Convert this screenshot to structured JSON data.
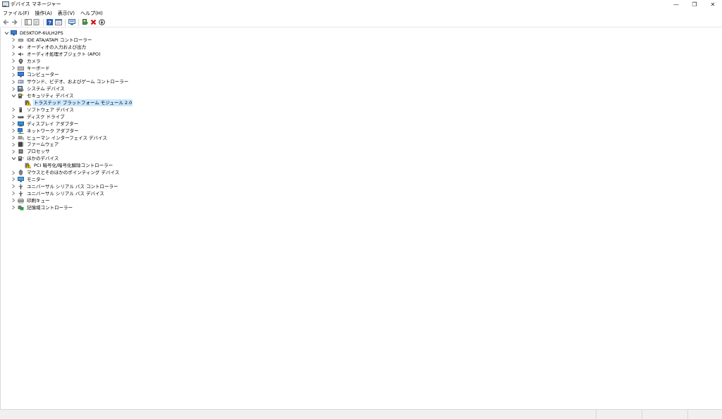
{
  "window": {
    "title": "デバイス マネージャー",
    "minimize_glyph": "—",
    "restore_glyph": "❐",
    "close_glyph": "✕"
  },
  "menu": {
    "items": [
      {
        "label": "ファイル(F)"
      },
      {
        "label": "操作(A)"
      },
      {
        "label": "表示(V)"
      },
      {
        "label": "ヘルプ(H)"
      }
    ]
  },
  "toolbar": {
    "buttons": [
      {
        "icon": "back-arrow-icon"
      },
      {
        "icon": "forward-arrow-icon"
      },
      {
        "icon": "show-hide-console-tree-icon"
      },
      {
        "icon": "properties-icon"
      },
      {
        "icon": "help-icon"
      },
      {
        "icon": "view-icon"
      },
      {
        "icon": "scan-hardware-icon"
      },
      {
        "icon": "update-driver-icon"
      },
      {
        "icon": "uninstall-device-icon"
      },
      {
        "icon": "disable-device-icon"
      }
    ]
  },
  "tree": {
    "root": {
      "label": "DESKTOP-6ULH2PS",
      "icon": "computer-icon"
    },
    "categories": [
      {
        "label": "IDE ATA/ATAPI コントローラー",
        "icon": "ide-controller-icon",
        "expanded": false
      },
      {
        "label": "オーディオの入力および出力",
        "icon": "speaker-icon",
        "expanded": false
      },
      {
        "label": "オーディオ処理オブジェクト (APO)",
        "icon": "audio-processing-icon",
        "expanded": false
      },
      {
        "label": "カメラ",
        "icon": "camera-icon",
        "expanded": false
      },
      {
        "label": "キーボード",
        "icon": "keyboard-icon",
        "expanded": false
      },
      {
        "label": "コンピューター",
        "icon": "computer-icon",
        "expanded": false
      },
      {
        "label": "サウンド、ビデオ、およびゲーム コントローラー",
        "icon": "sound-icon",
        "expanded": false
      },
      {
        "label": "システム デバイス",
        "icon": "system-device-icon",
        "expanded": false
      },
      {
        "label": "セキュリティ デバイス",
        "icon": "security-device-icon",
        "expanded": true,
        "children": [
          {
            "label": "トラステッド プラットフォーム モジュール 2.0",
            "icon": "tpm-warning-icon",
            "selected": true
          }
        ]
      },
      {
        "label": "ソフトウェア デバイス",
        "icon": "software-device-icon",
        "expanded": false
      },
      {
        "label": "ディスク ドライブ",
        "icon": "disk-drive-icon",
        "expanded": false
      },
      {
        "label": "ディスプレイ アダプター",
        "icon": "display-adapter-icon",
        "expanded": false
      },
      {
        "label": "ネットワーク アダプター",
        "icon": "network-adapter-icon",
        "expanded": false
      },
      {
        "label": "ヒューマン インターフェイス デバイス",
        "icon": "hid-icon",
        "expanded": false
      },
      {
        "label": "ファームウェア",
        "icon": "firmware-icon",
        "expanded": false
      },
      {
        "label": "プロセッサ",
        "icon": "processor-icon",
        "expanded": false
      },
      {
        "label": "ほかのデバイス",
        "icon": "other-device-icon",
        "expanded": true,
        "children": [
          {
            "label": "PCI 暗号化/暗号化解除コントローラー",
            "icon": "unknown-device-warning-icon",
            "selected": false
          }
        ]
      },
      {
        "label": "マウスとそのほかのポインティング デバイス",
        "icon": "mouse-icon",
        "expanded": false
      },
      {
        "label": "モニター",
        "icon": "monitor-icon",
        "expanded": false
      },
      {
        "label": "ユニバーサル シリアル バス コントローラー",
        "icon": "usb-icon",
        "expanded": false
      },
      {
        "label": "ユニバーサル シリアル バス デバイス",
        "icon": "usb-icon",
        "expanded": false
      },
      {
        "label": "印刷キュー",
        "icon": "printer-icon",
        "expanded": false
      },
      {
        "label": "記憶域コントローラー",
        "icon": "storage-controller-icon",
        "expanded": false
      }
    ]
  },
  "colors": {
    "selection": "#cce8ff",
    "accent": "#0078d7",
    "warning": "#f0c000",
    "danger": "#d00000",
    "green": "#2a9d3a"
  }
}
